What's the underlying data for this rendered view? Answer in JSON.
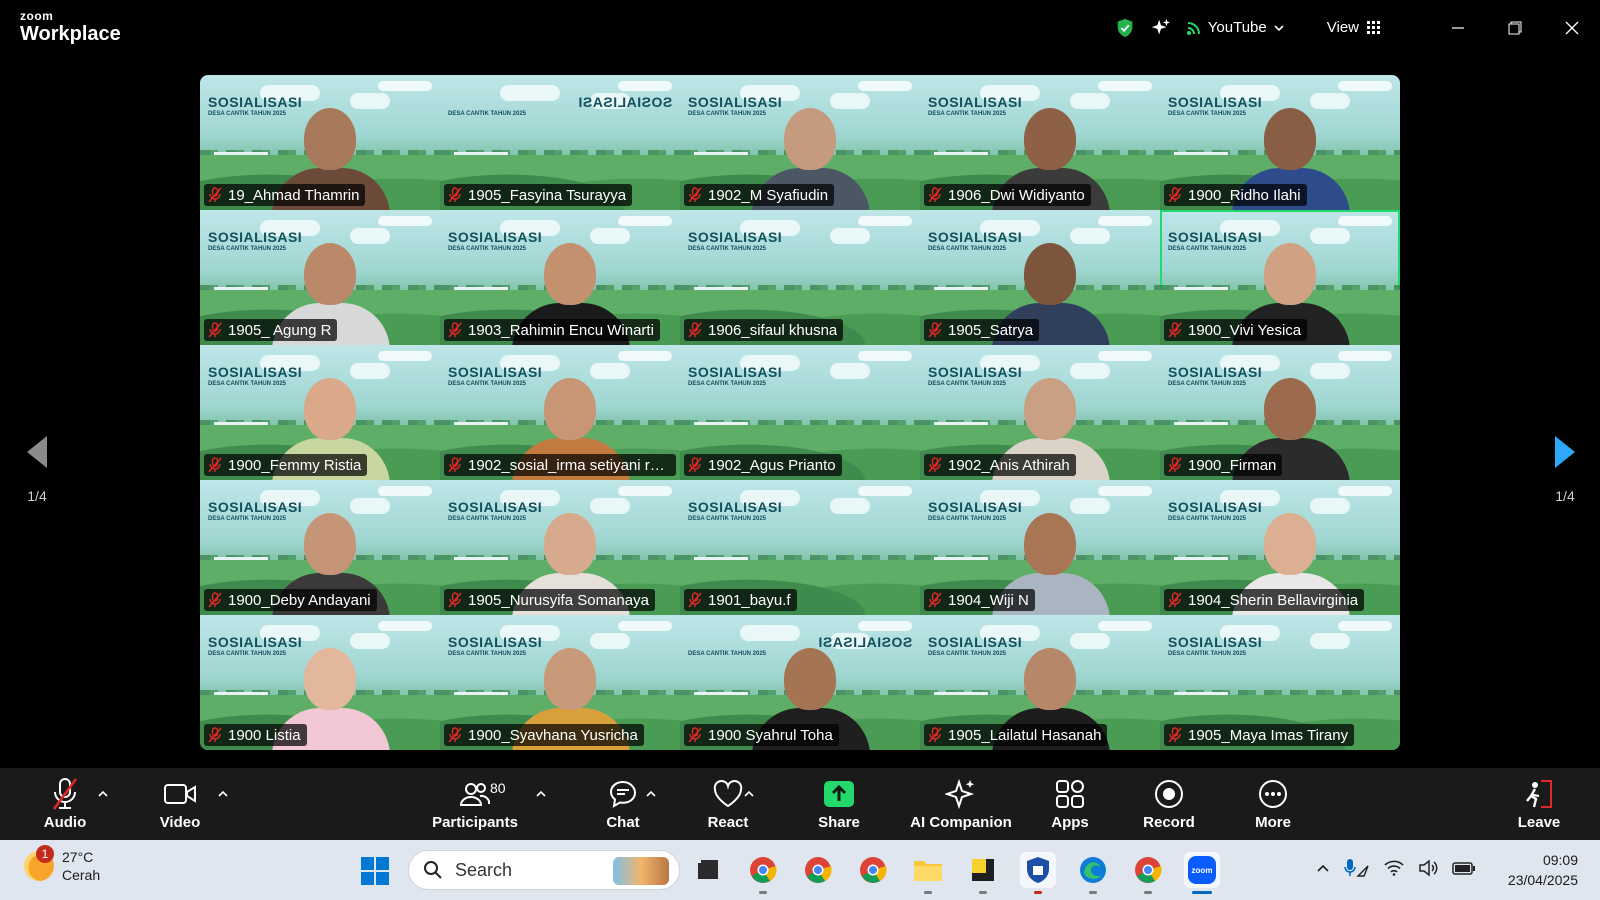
{
  "app": {
    "brand_small": "zoom",
    "brand_big": "Workplace"
  },
  "titlebar": {
    "stream_label": "YouTube",
    "view_label": "View"
  },
  "slide": {
    "title": "SOSIALISASI",
    "subtitle": "DESA CANTIK TAHUN 2025"
  },
  "paging": {
    "left": "1/4",
    "right": "1/4"
  },
  "participants_grid": [
    {
      "name": "19_Ahmad Thamrin",
      "skin": "#a8785a",
      "shirt": "#6b4a3a",
      "mirrored": false
    },
    {
      "name": "1905_Fasyina Tsurayya",
      "skin": "",
      "shirt": "",
      "mirrored": true
    },
    {
      "name": "1902_M Syafiudin",
      "skin": "#c69a7c",
      "shirt": "#4c5766",
      "mirrored": false
    },
    {
      "name": "1906_Dwi Widiyanto",
      "skin": "#8e6046",
      "shirt": "#3b3b3b",
      "mirrored": false
    },
    {
      "name": "1900_Ridho Ilahi",
      "skin": "#8a5e44",
      "shirt": "#2e4b8c",
      "mirrored": false
    },
    {
      "name": "1905_ Agung R",
      "skin": "#b9896a",
      "shirt": "#d8d8d8",
      "mirrored": false
    },
    {
      "name": "1903_Rahimin Encu Winarti",
      "skin": "#c4916f",
      "shirt": "#1b1b1b",
      "mirrored": false
    },
    {
      "name": "1906_sifaul khusna",
      "skin": "",
      "shirt": "",
      "mirrored": false
    },
    {
      "name": "1905_Satrya",
      "skin": "#7d553d",
      "shirt": "#2f3f5c",
      "mirrored": false
    },
    {
      "name": "1900_Vivi Yesica",
      "skin": "#d0a183",
      "shirt": "#222222",
      "mirrored": false
    },
    {
      "name": "1900_Femmy Ristia",
      "skin": "#d9a98a",
      "shirt": "#c8d6a0",
      "mirrored": false
    },
    {
      "name": "1902_sosial_irma setiyani ra...",
      "skin": "#c89575",
      "shirt": "#c27a3f",
      "mirrored": false
    },
    {
      "name": "1902_Agus Prianto",
      "skin": "",
      "shirt": "",
      "mirrored": false
    },
    {
      "name": "1902_Anis Athirah",
      "skin": "#caa085",
      "shirt": "#d9d3c8",
      "mirrored": false
    },
    {
      "name": "1900_Firman",
      "skin": "#9c6b4d",
      "shirt": "#2b2b2b",
      "mirrored": false
    },
    {
      "name": "1900_Deby Andayani",
      "skin": "#c69578",
      "shirt": "#3a3a3a",
      "mirrored": false
    },
    {
      "name": "1905_Nurusyifa Somanaya",
      "skin": "#d7aa8d",
      "shirt": "#e6e0da",
      "mirrored": false
    },
    {
      "name": "1901_bayu.f",
      "skin": "",
      "shirt": "",
      "mirrored": false
    },
    {
      "name": "1904_Wiji N",
      "skin": "#a87654",
      "shirt": "#a9b6c2",
      "mirrored": false
    },
    {
      "name": "1904_Sherin Bellavirginia",
      "skin": "#dcae92",
      "shirt": "#e8e8e8",
      "mirrored": false
    },
    {
      "name": "1900 Listia",
      "skin": "#e3b79c",
      "shirt": "#f1c7d3",
      "mirrored": false
    },
    {
      "name": "1900_Syavhana Yusricha",
      "skin": "#c99a7a",
      "shirt": "#d8a03a",
      "mirrored": false
    },
    {
      "name": "1900 Syahrul Toha",
      "skin": "#a57452",
      "shirt": "#1f1f1f",
      "mirrored": true
    },
    {
      "name": "1905_Lailatul Hasanah",
      "skin": "#b7876a",
      "shirt": "#1d1d1d",
      "mirrored": false
    },
    {
      "name": "1905_Maya Imas Tirany",
      "skin": "",
      "shirt": "",
      "mirrored": false
    }
  ],
  "toolbar": {
    "audio": "Audio",
    "video": "Video",
    "participants": "Participants",
    "participants_count": "80",
    "chat": "Chat",
    "react": "React",
    "share": "Share",
    "ai_companion": "AI Companion",
    "apps": "Apps",
    "record": "Record",
    "more": "More",
    "leave": "Leave"
  },
  "taskbar": {
    "weather_badge": "1",
    "temperature": "27°C",
    "condition": "Cerah",
    "search_placeholder": "Search",
    "time": "09:09",
    "date": "23/04/2025"
  },
  "colors": {
    "active_speaker": "#23d96b",
    "share_green": "#23d96b",
    "muted_red": "#e02828"
  }
}
